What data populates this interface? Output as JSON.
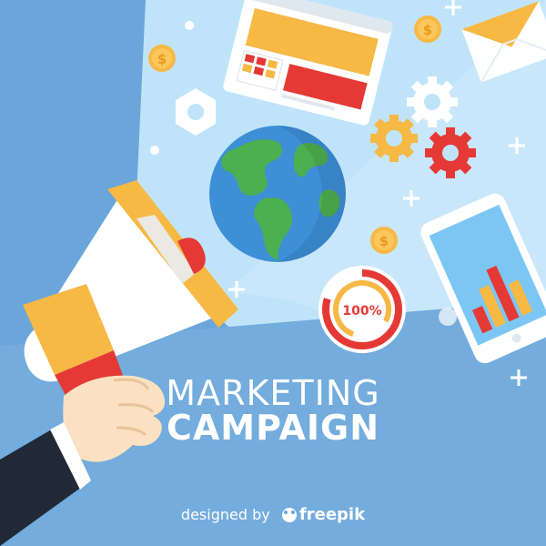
{
  "headline": {
    "line1": "MARKETING",
    "line2": "CAMPAIGN"
  },
  "gauge": {
    "label": "100%"
  },
  "credit": {
    "prefix": "designed by",
    "brand": "freepik"
  },
  "colors": {
    "background": "#6aa6d9",
    "beam": "#bfe4fa",
    "accent_red": "#e53935",
    "accent_yellow": "#f7b844",
    "globe_ocean": "#3d8fd6",
    "globe_land": "#4caf50"
  },
  "icons": [
    "megaphone-icon",
    "hand-icon",
    "globe-icon",
    "coin-icon",
    "gear-icon",
    "hexagon-icon",
    "envelope-icon",
    "smartphone-icon",
    "browser-window-icon",
    "progress-ring-icon",
    "sparkle-icon",
    "freepik-logo-icon"
  ]
}
